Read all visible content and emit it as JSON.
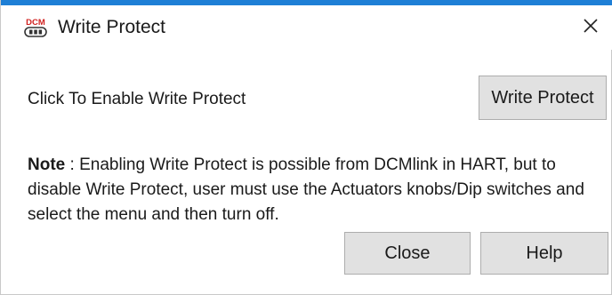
{
  "window": {
    "title": "Write Protect",
    "icon": "dcm-app-icon",
    "icon_label": "DCM"
  },
  "content": {
    "prompt_label": "Click To Enable Write Protect",
    "write_protect_button": "Write Protect",
    "note_label": "Note",
    "note_separator": " :",
    "note_text": "  Enabling Write Protect is possible from DCMlink in HART, but to disable Write Protect, user must use the Actuators knobs/Dip switches and select the menu and then turn off."
  },
  "footer": {
    "close_button": "Close",
    "help_button": "Help"
  },
  "colors": {
    "accent": "#1e7fd6",
    "button_face": "#e1e1e1",
    "button_border": "#adadad",
    "icon_red": "#d0201f"
  }
}
